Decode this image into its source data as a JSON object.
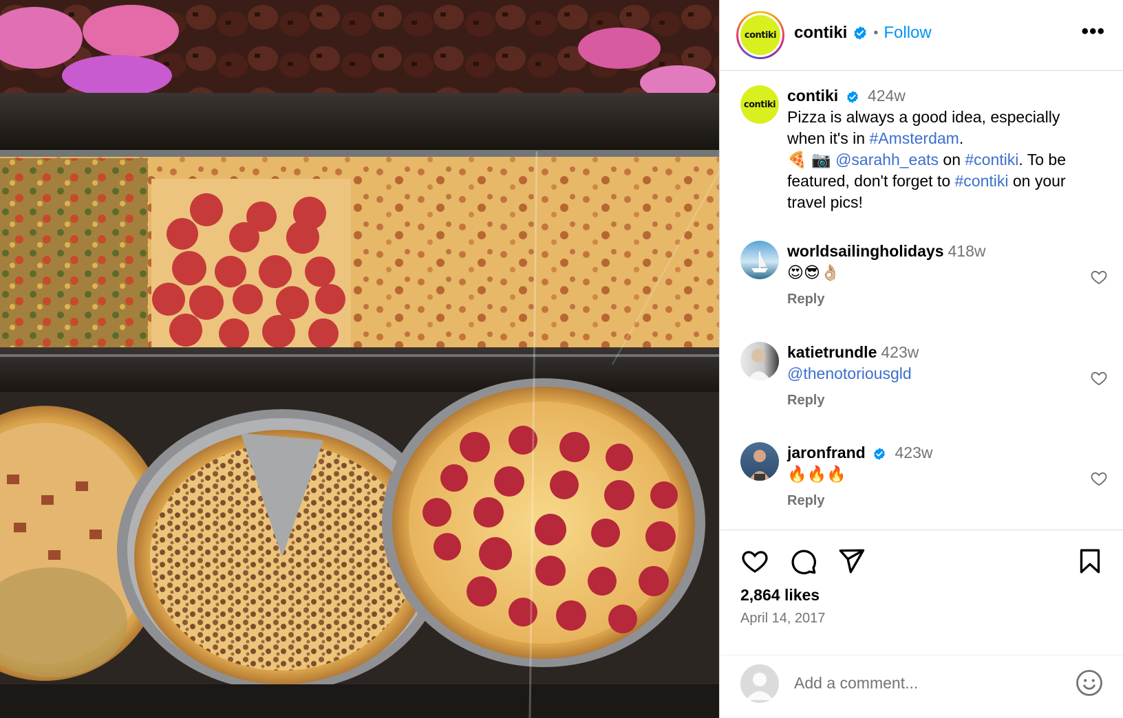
{
  "post": {
    "account": "contiki",
    "logo_text": "contiki",
    "follow_label": "Follow",
    "separator": "•",
    "more_label": "•••"
  },
  "caption": {
    "username": "contiki",
    "age": "424w",
    "line1": "Pizza is always a good idea, especially",
    "line2_prefix": "when it's in ",
    "line2_tag": "#Amsterdam",
    "line2_suffix": ".",
    "line3_emoji": "🍕 📷",
    "line3_mention": "@sarahh_eats",
    "line3_on": " on ",
    "line3_tag": "#contiki",
    "line3_suffix": ". To be",
    "line4_prefix": "featured, don't forget to ",
    "line4_tag": "#contiki",
    "line4_suffix": " on your",
    "line5": "travel pics!"
  },
  "comments": [
    {
      "username": "worldsailingholidays",
      "age": "418w",
      "text": "😍😎👌🏼",
      "reply_label": "Reply",
      "verified": false
    },
    {
      "username": "katietrundle",
      "age": "423w",
      "text": "@thenotoriousgld",
      "reply_label": "Reply",
      "verified": false
    },
    {
      "username": "jaronfrand",
      "age": "423w",
      "text": "🔥🔥🔥",
      "reply_label": "Reply",
      "verified": true
    }
  ],
  "footer": {
    "likes": "2,864 likes",
    "date": "April 14, 2017",
    "comment_placeholder": "Add a comment..."
  },
  "colors": {
    "link": "#3b6fcf",
    "follow": "#0095f6",
    "verified": "#0095f6",
    "muted": "#737373",
    "brand": "#d7f01e"
  },
  "icons": [
    "verified-badge-icon",
    "more-options-icon",
    "heart-icon",
    "comment-icon",
    "share-icon",
    "bookmark-icon",
    "emoji-icon",
    "default-avatar-icon"
  ]
}
